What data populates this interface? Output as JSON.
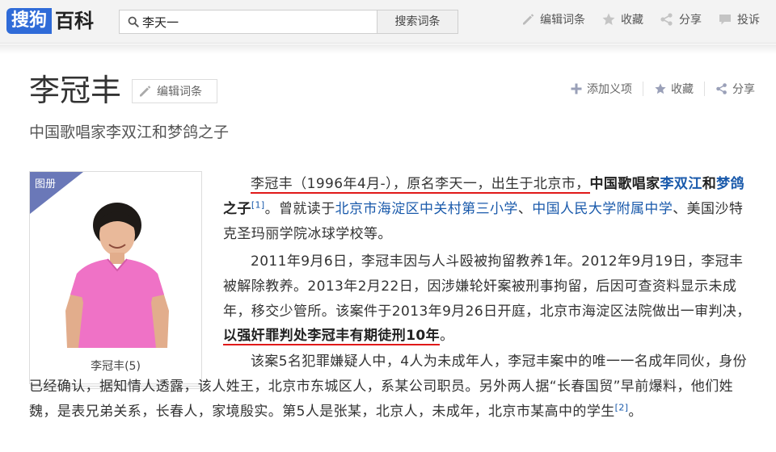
{
  "topbar": {
    "logo_box": "搜狗",
    "logo_text": "百科",
    "search_value": "李天一",
    "search_button": "搜索词条",
    "actions": [
      "编辑词条",
      "收藏",
      "分享",
      "投诉"
    ]
  },
  "header": {
    "title": "李冠丰",
    "edit_button": "编辑词条",
    "subtitle": "中国歌唱家李双江和梦鸽之子",
    "actions": [
      "添加义项",
      "收藏",
      "分享"
    ]
  },
  "album": {
    "ribbon": "图册",
    "caption": "李冠丰(5)"
  },
  "paragraph1": {
    "t1": "李冠丰（1996年4月-），原名李天一，",
    "t2": "出生于北京市，",
    "t3": "中国歌唱家",
    "link1": "李双江",
    "t4": "和",
    "link2": "梦鸽",
    "t5": "之子",
    "ref": "[1]",
    "t6": "。曾就读于",
    "link3": "北京市海淀区中关村第三小学",
    "t7": "、",
    "link4": "中国人民大学附属中学",
    "t8": "、美国沙特克圣玛丽学院冰球学校等。"
  },
  "paragraph2": {
    "t1": "2011年9月6日，李冠丰因与人斗殴被拘留教养1年。2012年9月19日，李冠丰被解除教养。2013年2月22日，因涉嫌轮奸案被刑事拘留，后因可查资料显示未成年，移交少管所。该案件于2013年9月26日开庭，北京市海淀区法院做出一审判决，",
    "bold": "以强奸罪判处李冠丰有期徒刑10年",
    "t2": "。"
  },
  "paragraph3": {
    "t1": "该案5名犯罪嫌疑人中，4人为未成年人，李冠丰案中的唯一一名成年同伙，身份已经确认，据知情人透露，该人姓王，北京市东城区人，系某公司职员。另外两人据“长春国贸”早前爆料，他们姓魏，是表兄弟关系，长春人，家境殷实。第5人是张某，北京人，未成年，北京市某高中的学生",
    "ref": "[2]",
    "t2": "。"
  },
  "colors": {
    "brand_blue": "#2f6bd8",
    "link": "#1a5aab",
    "ribbon": "#6a78b8",
    "underline_red": "#e01919"
  },
  "icons": [
    "search-icon",
    "pencil-icon",
    "star-icon",
    "share-icon",
    "comment-icon",
    "plus-icon"
  ]
}
